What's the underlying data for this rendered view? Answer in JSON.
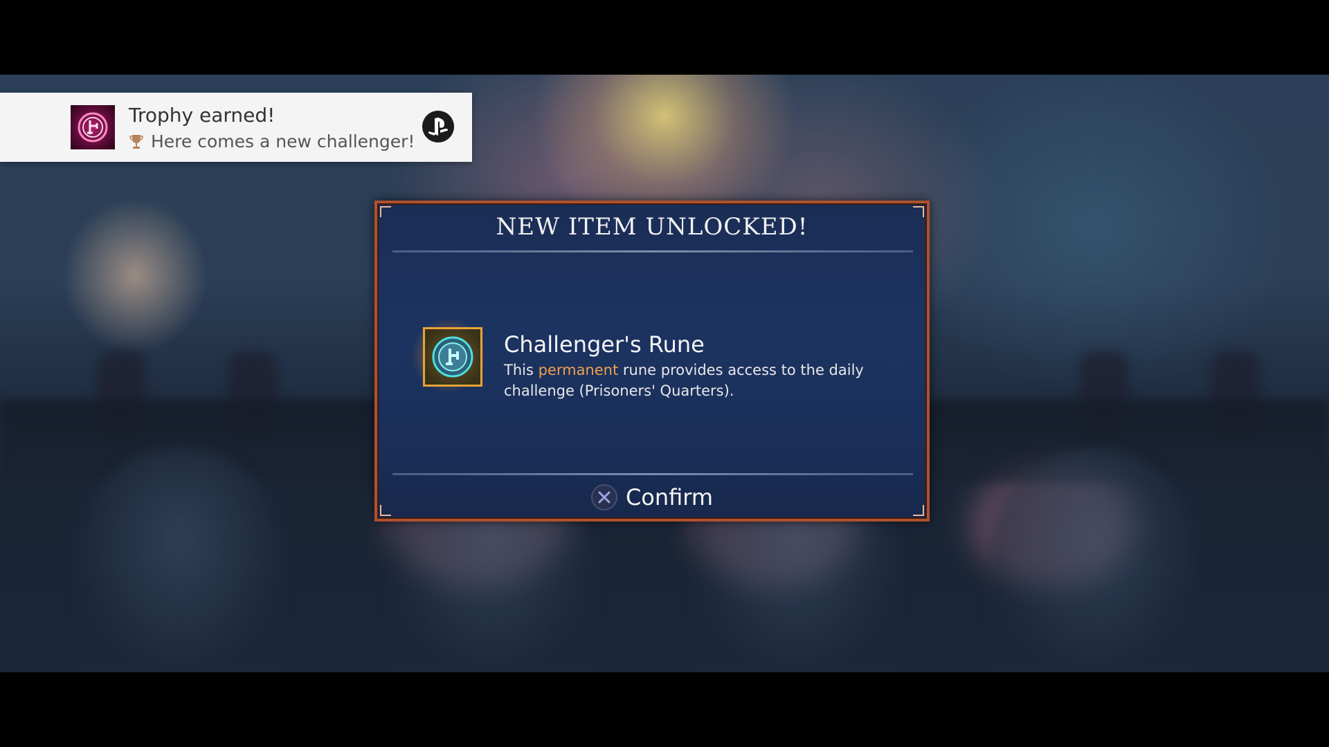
{
  "notification": {
    "title": "Trophy earned!",
    "subtitle": "Here comes a new challenger!"
  },
  "dialog": {
    "title": "NEW ITEM UNLOCKED!",
    "item": {
      "name": "Challenger's Rune",
      "desc_before": "This ",
      "desc_highlight": "permanent",
      "desc_after": " rune provides access to the daily challenge (Prisoners' Quarters).",
      "highlight_color": "#f0a04a"
    },
    "confirm_label": "Confirm"
  },
  "icons": {
    "trophy_badge": "rune-trophy-icon",
    "trophy_cup": "trophy-cup-icon",
    "platform": "playstation-icon",
    "item": "challengers-rune-icon",
    "confirm_button": "cross-button-icon"
  },
  "colors": {
    "dialog_border": "#b0512e",
    "dialog_bg": "#1c3361",
    "rune_frame": "#e8a437",
    "rune_glyph": "#4fe0e0",
    "trophy_icon_bg": "#b0206a"
  }
}
